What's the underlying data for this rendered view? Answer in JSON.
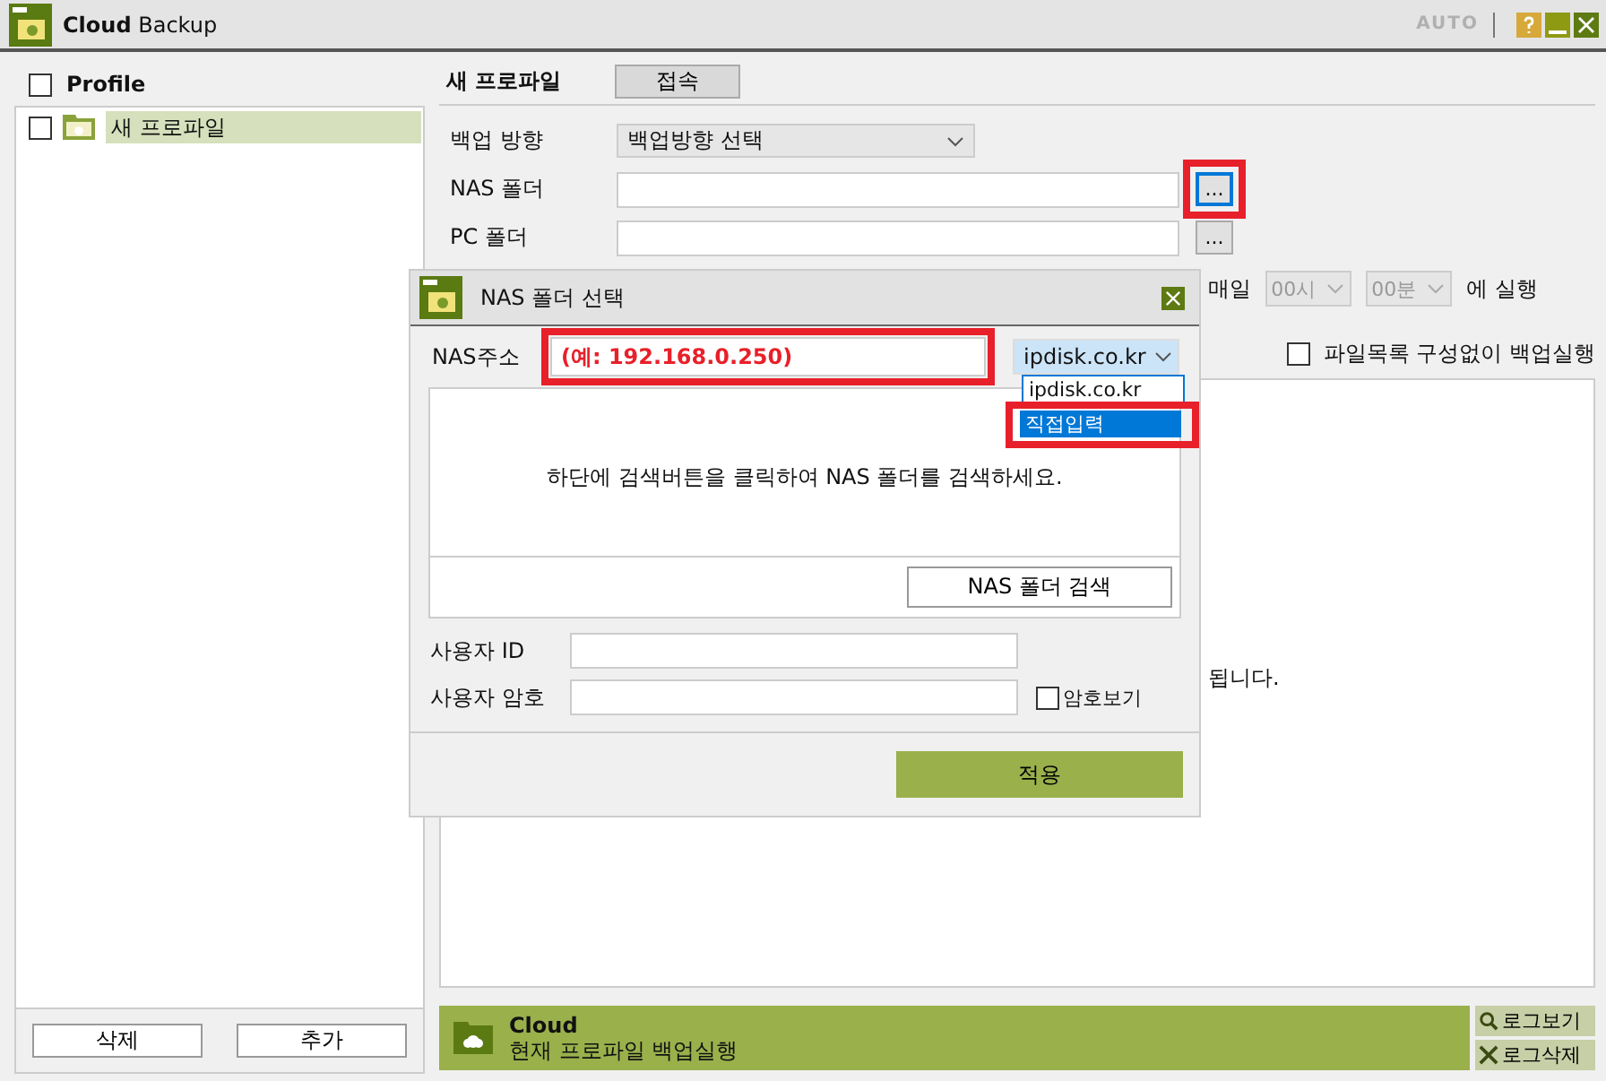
{
  "window": {
    "title_bold": "Cloud",
    "title_light": "Backup",
    "mode_label": "AUTO"
  },
  "profiles": {
    "header": "Profile",
    "header_checked": false,
    "items": [
      {
        "name": "새 프로파일",
        "checked": false,
        "selected": true
      }
    ]
  },
  "left_buttons": [
    "삭제",
    "추가"
  ],
  "profile_form": {
    "title": "새 프로파일",
    "connect_button": "접속",
    "fields": [
      {
        "kind": "select",
        "label": "백업 방향",
        "value": "백업방향 선택"
      },
      {
        "kind": "browse",
        "label": "NAS 폴더",
        "button": "...",
        "focused": true,
        "highlighted": true
      },
      {
        "kind": "browse",
        "label": "PC 폴더",
        "button": "...",
        "focused": false
      }
    ],
    "schedule": {
      "label": "매일",
      "hour": "00시",
      "minute": "00분",
      "suffix": "에 실행"
    },
    "skip_list": {
      "label": "파일목록 구성없이 백업실행",
      "checked": false
    },
    "message_fragment": "됩니다."
  },
  "status_bar": {
    "title": "Cloud",
    "text": "현재 프로파일 백업실행",
    "buttons": [
      {
        "kind": "view",
        "label": "로그보기"
      },
      {
        "kind": "delete",
        "label": "로그삭제"
      }
    ]
  },
  "dialog": {
    "title": "NAS 폴더 선택",
    "address_label": "NAS주소",
    "address_placeholder": "(예: 192.168.0.250)",
    "address_highlighted": true,
    "domain": "ipdisk.co.kr",
    "domain_options": [
      {
        "label": "ipdisk.co.kr",
        "selected": false
      },
      {
        "label": "직접입력",
        "selected": true,
        "highlighted": true
      }
    ],
    "hint": "하단에 검색버튼을 클릭하여 NAS 폴더를 검색하세요.",
    "search_button": "NAS 폴더 검색",
    "user_id_label": "사용자 ID",
    "password_label": "사용자 암호",
    "show_password": {
      "label": "암호보기",
      "checked": false
    },
    "apply_button": "적용"
  }
}
